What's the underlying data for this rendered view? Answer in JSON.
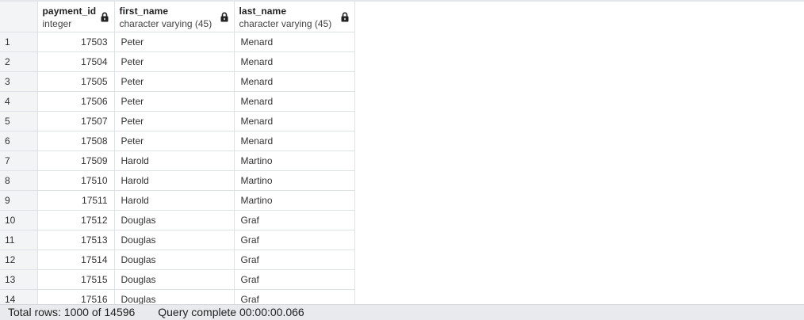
{
  "columns": [
    {
      "name": "payment_id",
      "type": "integer"
    },
    {
      "name": "first_name",
      "type": "character varying (45)"
    },
    {
      "name": "last_name",
      "type": "character varying (45)"
    }
  ],
  "rows": [
    {
      "index": "1",
      "payment_id": "17503",
      "first_name": "Peter",
      "last_name": "Menard"
    },
    {
      "index": "2",
      "payment_id": "17504",
      "first_name": "Peter",
      "last_name": "Menard"
    },
    {
      "index": "3",
      "payment_id": "17505",
      "first_name": "Peter",
      "last_name": "Menard"
    },
    {
      "index": "4",
      "payment_id": "17506",
      "first_name": "Peter",
      "last_name": "Menard"
    },
    {
      "index": "5",
      "payment_id": "17507",
      "first_name": "Peter",
      "last_name": "Menard"
    },
    {
      "index": "6",
      "payment_id": "17508",
      "first_name": "Peter",
      "last_name": "Menard"
    },
    {
      "index": "7",
      "payment_id": "17509",
      "first_name": "Harold",
      "last_name": "Martino"
    },
    {
      "index": "8",
      "payment_id": "17510",
      "first_name": "Harold",
      "last_name": "Martino"
    },
    {
      "index": "9",
      "payment_id": "17511",
      "first_name": "Harold",
      "last_name": "Martino"
    },
    {
      "index": "10",
      "payment_id": "17512",
      "first_name": "Douglas",
      "last_name": "Graf"
    },
    {
      "index": "11",
      "payment_id": "17513",
      "first_name": "Douglas",
      "last_name": "Graf"
    },
    {
      "index": "12",
      "payment_id": "17514",
      "first_name": "Douglas",
      "last_name": "Graf"
    },
    {
      "index": "13",
      "payment_id": "17515",
      "first_name": "Douglas",
      "last_name": "Graf"
    },
    {
      "index": "14",
      "payment_id": "17516",
      "first_name": "Douglas",
      "last_name": "Graf"
    }
  ],
  "status": {
    "total_rows": "Total rows: 1000 of 14596",
    "query_complete": "Query complete 00:00:00.066"
  },
  "icons": {
    "column_lock": "lock-icon"
  }
}
